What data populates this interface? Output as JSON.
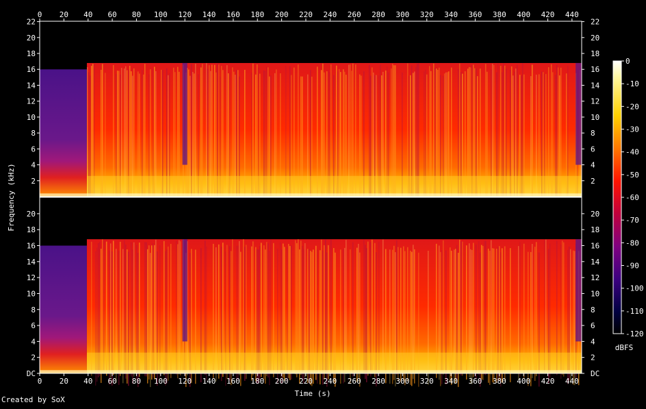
{
  "chart_data": {
    "type": "heatmap",
    "xlabel": "Time (s)",
    "ylabel": "Frequency (kHz)",
    "colorbar_label": "dBFS",
    "xlim": [
      0,
      448
    ],
    "ylim": [
      0,
      22.05
    ],
    "x_ticks": [
      "0",
      "20",
      "40",
      "60",
      "80",
      "100",
      "120",
      "140",
      "160",
      "180",
      "200",
      "220",
      "240",
      "260",
      "280",
      "300",
      "320",
      "340",
      "360",
      "380",
      "400",
      "420",
      "440"
    ],
    "y_ticks_top": [
      "2",
      "4",
      "6",
      "8",
      "10",
      "12",
      "14",
      "16",
      "18",
      "20",
      "22"
    ],
    "y_ticks_bottom": [
      "DC",
      "2",
      "4",
      "6",
      "8",
      "10",
      "12",
      "14",
      "16",
      "18",
      "20"
    ],
    "colorbar_ticks": [
      "0",
      "-10",
      "-20",
      "-30",
      "-40",
      "-50",
      "-60",
      "-70",
      "-80",
      "-90",
      "-100",
      "-110",
      "-120"
    ],
    "colorbar_range": [
      -120,
      0
    ],
    "channels": [
      {
        "name": "",
        "cutoff_khz": [
          {
            "t_start": 0,
            "t_end": 39,
            "khz": 16.0
          },
          {
            "t_start": 39,
            "t_end": 448,
            "khz": 16.8
          }
        ]
      },
      {
        "name": "",
        "cutoff_khz": [
          {
            "t_start": 0,
            "t_end": 39,
            "khz": 16.0
          },
          {
            "t_start": 39,
            "t_end": 448,
            "khz": 16.8
          }
        ]
      }
    ],
    "colors": {
      "background": "#000000",
      "frame": "#ffffff",
      "quiet": "#500080",
      "mid": "#e81010",
      "loud": "#ffd000",
      "peak": "#fffff0"
    }
  },
  "footer": {
    "credit": "Created by SoX"
  }
}
